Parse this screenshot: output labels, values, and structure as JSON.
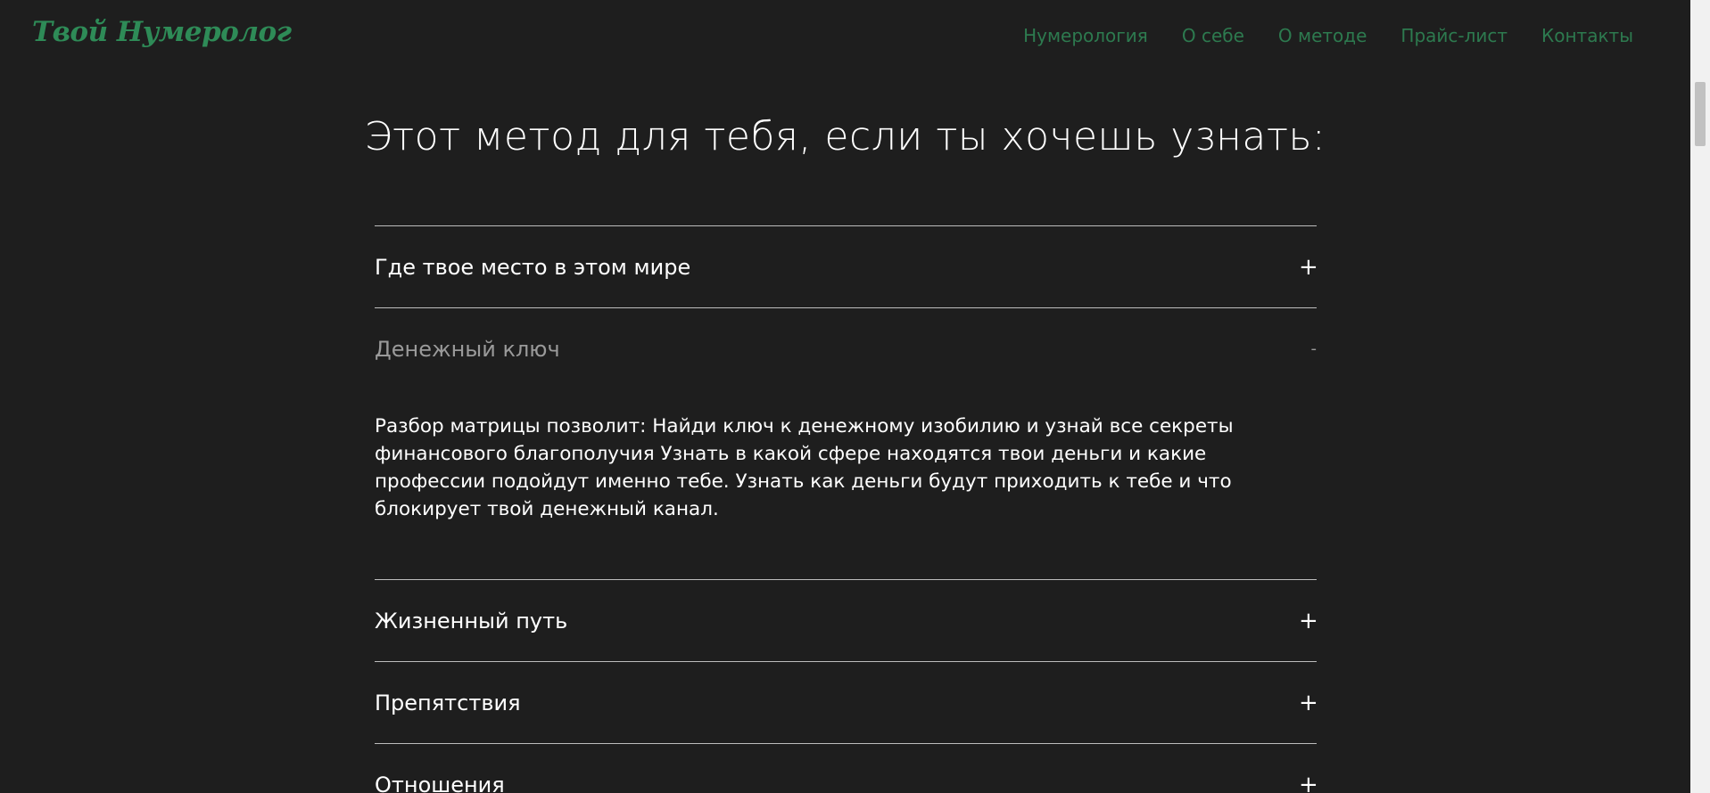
{
  "header": {
    "logo": "Твой Нумеролог",
    "nav": [
      {
        "label": "Нумерология"
      },
      {
        "label": "О себе"
      },
      {
        "label": "О методе"
      },
      {
        "label": "Прайс-лист"
      },
      {
        "label": "Контакты"
      }
    ]
  },
  "main": {
    "heading": "Этот метод для тебя, если ты хочешь узнать:",
    "accordion": [
      {
        "title": "Где твое место в этом мире",
        "sign": "+",
        "expanded": false
      },
      {
        "title": "Денежный ключ",
        "sign": "-",
        "expanded": true,
        "body": "Разбор матрицы позволит: Найди ключ к денежному изобилию и узнай все секреты финансового благополучия Узнать в какой сфере находятся твои деньги и какие профессии подойдут именно тебе. Узнать как деньги будут приходить к тебе и что блокирует твой денежный канал."
      },
      {
        "title": "Жизненный путь",
        "sign": "+",
        "expanded": false
      },
      {
        "title": "Препятствия",
        "sign": "+",
        "expanded": false
      },
      {
        "title": "Отношения",
        "sign": "+",
        "expanded": false
      }
    ]
  },
  "colors": {
    "background": "#1e1e1e",
    "brand_green": "#2e8b57",
    "nav_green": "#2d7a4f",
    "divider": "#bdbdbd",
    "muted_text": "#9a9a9a"
  }
}
